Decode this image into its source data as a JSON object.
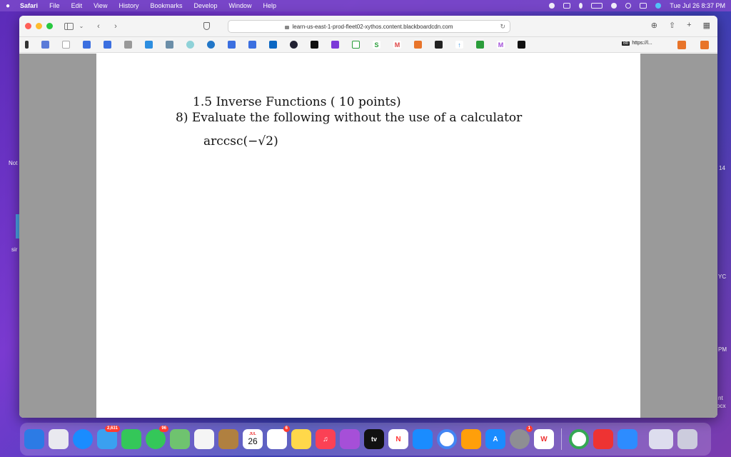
{
  "menubar": {
    "app_name": "Safari",
    "items": [
      "File",
      "Edit",
      "View",
      "History",
      "Bookmarks",
      "Develop",
      "Window",
      "Help"
    ],
    "clock": "Tue Jul 26  8:37 PM"
  },
  "desktop": {
    "left_labels": [
      "Not",
      "sir"
    ],
    "right_labels": [
      "14",
      "YC",
      "PM",
      "nt",
      "ocx"
    ]
  },
  "browser": {
    "url": "learn-us-east-1-prod-fleet02-xythos.content.blackboardcdn.com",
    "bookmark_text": "https://l...",
    "bookmark_bb": "Bb"
  },
  "document": {
    "section": "1.5   Inverse Functions   ( 10 points)",
    "question": "8) Evaluate the following without the use of a calculator",
    "expression": "arccsc(−√2)"
  },
  "dock": {
    "mail_badge": "2,631",
    "messages_badge": "96",
    "calendar_month": "JUL",
    "calendar_day": "26",
    "reminders_badge": "6",
    "appstore_badge": "1",
    "tv_label": "tv"
  },
  "colors": {
    "accent": "#7a3ad0",
    "page_bg": "#9a9a9a"
  }
}
